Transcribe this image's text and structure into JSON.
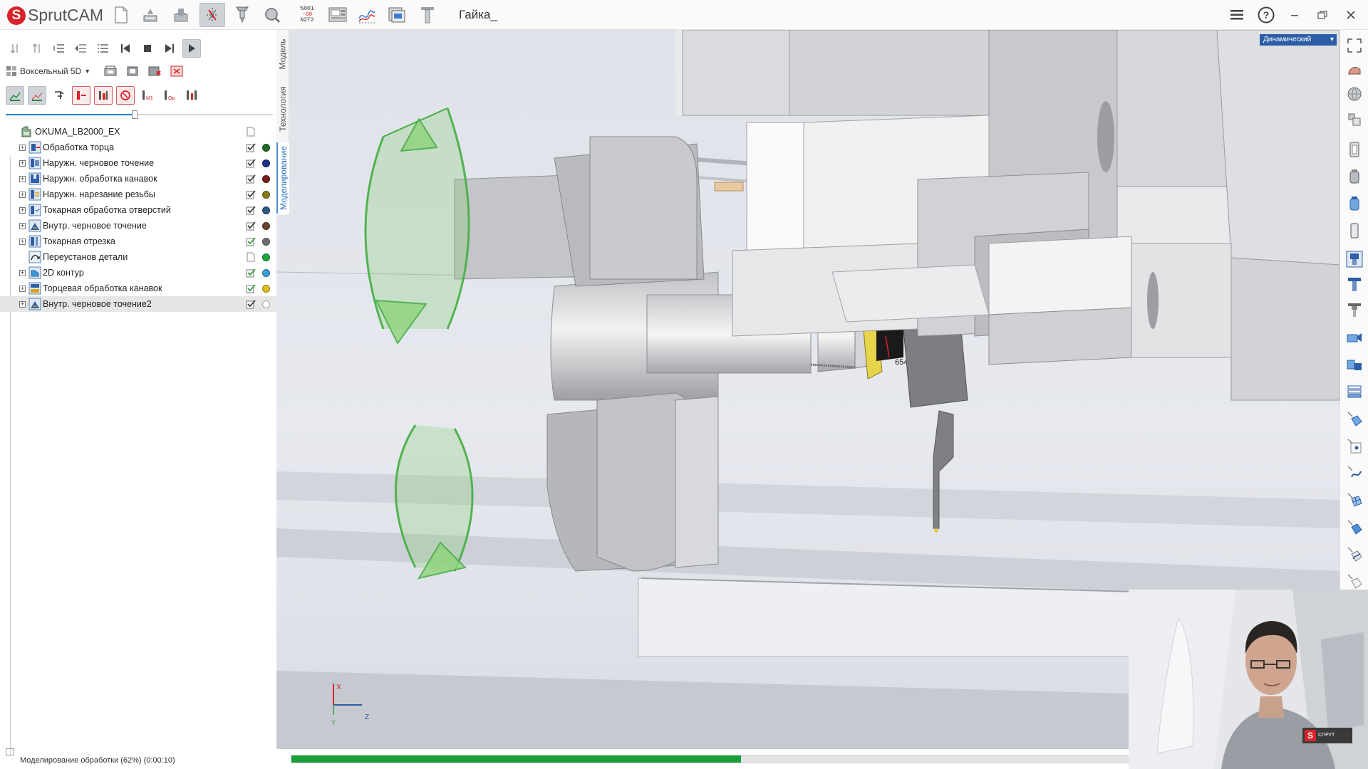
{
  "app": {
    "logo_text": "SprutCAM",
    "document_title": "Гайка_"
  },
  "colors": {
    "accent": "#1e7fd6",
    "brand": "#d8232a",
    "progress": "#18a13a",
    "rotation_gizmo": "#3aa83a"
  },
  "toolbar": {
    "buttons": [
      "new-file-icon",
      "open-file-icon",
      "save-file-icon",
      "machine-axes-icon",
      "tool-icon",
      "simulation-zoom-icon",
      "nc-program-icon",
      "machine-panel-icon",
      "toolpath-icon",
      "reports-icon",
      "tool-library-icon"
    ],
    "nc_icon_lines": [
      "%001",
      "-G0",
      "N2T2"
    ]
  },
  "left_toolbar": {
    "voxel_mode": "Воксельный 5D"
  },
  "vertical_tabs": {
    "model": "Модель",
    "technology": "Технология",
    "simulation": "Моделирование"
  },
  "tree": {
    "root": "OKUMA_LB2000_EX",
    "operations": [
      {
        "label": "Обработка торца",
        "dot": "#1e6b2a",
        "checked": "dark"
      },
      {
        "label": "Наружн. черновое точение",
        "dot": "#1c2f8c",
        "checked": "dark"
      },
      {
        "label": "Наружн. обработка канавок",
        "dot": "#7a1d1d",
        "checked": "dark"
      },
      {
        "label": "Наружн. нарезание резьбы",
        "dot": "#8a7a1c",
        "checked": "dark"
      },
      {
        "label": "Токарная обработка отверстий",
        "dot": "#2c5a86",
        "checked": "dark"
      },
      {
        "label": "Внутр. черновое точение",
        "dot": "#6b4030",
        "checked": "dark"
      },
      {
        "label": "Токарная отрезка",
        "dot": "#6e6e6e",
        "checked": "green"
      },
      {
        "label": "Переустанов детали",
        "dot": "#1da83a",
        "checked": "none"
      },
      {
        "label": "2D контур",
        "dot": "#3aa0d8",
        "checked": "green"
      },
      {
        "label": "Торцевая обработка канавок",
        "dot": "#e0c020",
        "checked": "green"
      },
      {
        "label": "Внутр. черновое точение2",
        "dot": "#ffffff",
        "checked": "dark"
      }
    ]
  },
  "simulation": {
    "progress_fraction": 0.51,
    "status_text": "Моделирование обработки (62%) (0:00:10)",
    "view_mode": "Динамический",
    "tool_label": "654",
    "axis_x": "X",
    "axis_z": "Z",
    "axis_y": "Y"
  },
  "webcam": {
    "badge_letter": "S",
    "badge_text": "СПРУТ"
  }
}
